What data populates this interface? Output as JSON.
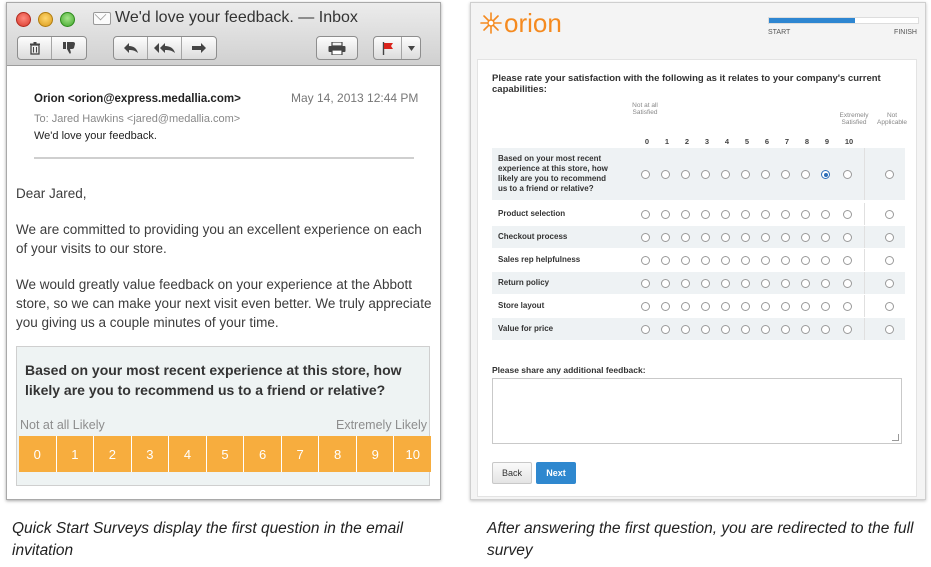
{
  "mail": {
    "window_title": "We'd love your feedback. — Inbox",
    "toolbar": {
      "delete": "trash-icon",
      "junk": "thumbs-down-icon",
      "reply": "reply-icon",
      "reply_all": "reply-all-icon",
      "forward": "forward-icon",
      "print": "printer-icon",
      "flag": "flag-icon",
      "flag_menu": "chevron-down-icon"
    },
    "from": "Orion <orion@express.medallia.com>",
    "date": "May 14, 2013  12:44 PM",
    "to": "To:   Jared Hawkins <jared@medallia.com>",
    "subject": "We'd love your feedback.",
    "greeting": "Dear Jared,",
    "para1": "We are committed to providing you an excellent experience on each of your visits to our store.",
    "para2": "We would greatly value feedback on your experience at the Abbott store, so we can make your next visit even better. We truly appreciate you giving us a couple minutes of your time.",
    "survey": {
      "question": "Based on your most recent experience at this store, how likely are you to recommend us to a friend or relative?",
      "low_label": "Not at all Likely",
      "high_label": "Extremely Likely",
      "scale": [
        "0",
        "1",
        "2",
        "3",
        "4",
        "5",
        "6",
        "7",
        "8",
        "9",
        "10"
      ]
    },
    "caption": "Quick Start Surveys display the first question in the email invitation"
  },
  "survey_page": {
    "logo": "orion",
    "progress": {
      "start": "START",
      "finish": "FINISH",
      "fraction": 0.58
    },
    "question": "Please rate your satisfaction with the following as it relates to your company's current capabilities:",
    "low_header": "Not at all Satisfied",
    "high_header": "Extremely Satisfied",
    "na_header": "Not Applicable",
    "scale": [
      "0",
      "1",
      "2",
      "3",
      "4",
      "5",
      "6",
      "7",
      "8",
      "9",
      "10"
    ],
    "rows": [
      {
        "label": "Based on your most recent experience at this store, how likely are you to recommend us to a friend or relative?",
        "selected": 9
      },
      {
        "label": "Product selection",
        "selected": null
      },
      {
        "label": "Checkout process",
        "selected": null
      },
      {
        "label": "Sales rep helpfulness",
        "selected": null
      },
      {
        "label": "Return policy",
        "selected": null
      },
      {
        "label": "Store layout",
        "selected": null
      },
      {
        "label": "Value for price",
        "selected": null
      }
    ],
    "feedback_label": "Please share any additional feedback:",
    "feedback_value": "",
    "back_label": "Back",
    "next_label": "Next",
    "caption": "After answering the first question, you are redirected to the full survey"
  }
}
